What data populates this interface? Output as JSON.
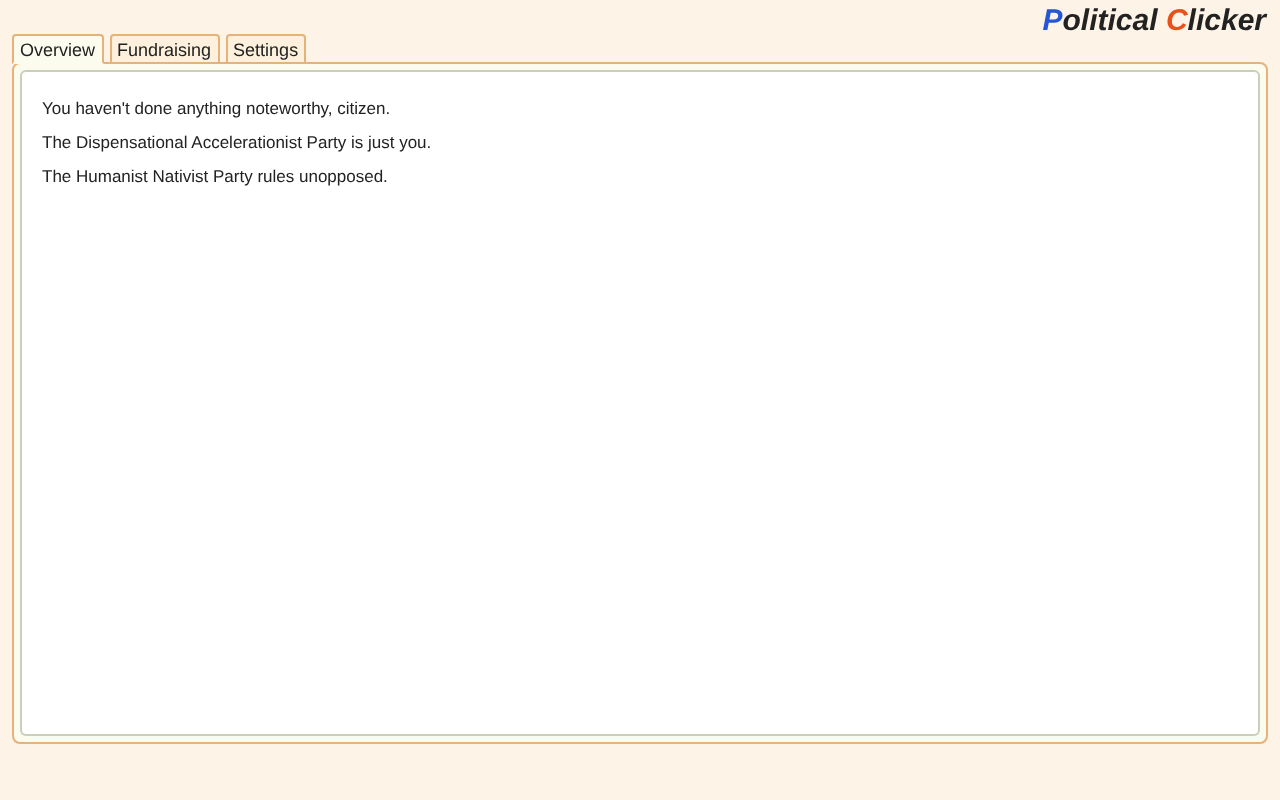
{
  "logo": [
    {
      "text": "P",
      "color": "#2456d6"
    },
    {
      "text": "olitical ",
      "color": "#222222"
    },
    {
      "text": "C",
      "color": "#e8521a"
    },
    {
      "text": "licker",
      "color": "#222222"
    }
  ],
  "tabs": [
    {
      "label": "Overview",
      "selected": true
    },
    {
      "label": "Fundraising",
      "selected": false
    },
    {
      "label": "Settings",
      "selected": false
    }
  ],
  "messages": [
    "You haven't done anything noteworthy, citizen.",
    "The Dispensational Accelerationist Party is just you.",
    "The Humanist Nativist Party rules unopposed."
  ]
}
